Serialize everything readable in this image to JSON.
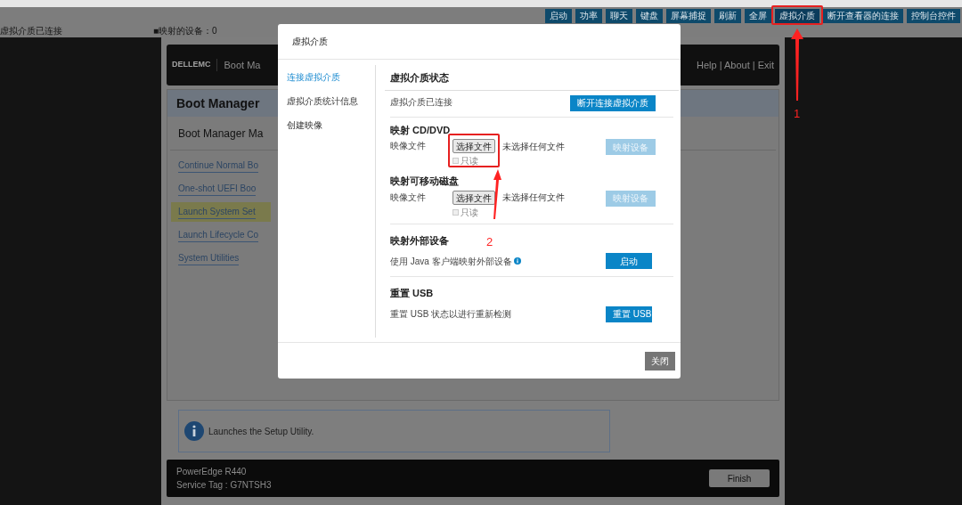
{
  "toolbar": {
    "buttons": [
      {
        "label": "启动",
        "selected": false
      },
      {
        "label": "功率",
        "selected": false
      },
      {
        "label": "聊天",
        "selected": false
      },
      {
        "label": "键盘",
        "selected": false
      },
      {
        "label": "屏幕捕捉",
        "selected": false
      },
      {
        "label": "刷新",
        "selected": false
      },
      {
        "label": "全屏",
        "selected": false
      },
      {
        "label": "虚拟介质",
        "selected": true
      },
      {
        "label": "断开查看器的连接",
        "selected": false
      },
      {
        "label": "控制台控件",
        "selected": false
      }
    ]
  },
  "status_bar": {
    "connection": "虚拟介质已连接",
    "mapped_devices": "■映射的设备：0"
  },
  "bios": {
    "brand": "DELLEMC",
    "header_title": "Boot Ma",
    "header_links": "Help | About | Exit",
    "panel_title": "Boot Manager",
    "section_title": "Boot Manager Ma",
    "items": [
      {
        "label": "Continue Normal Bo",
        "selected": false
      },
      {
        "label": "One-shot UEFI Boo",
        "selected": false
      },
      {
        "label": "Launch System Set",
        "selected": true
      },
      {
        "label": "Launch Lifecycle Co",
        "selected": false
      },
      {
        "label": "System Utilities",
        "selected": false
      }
    ],
    "info": "Launches the Setup Utility.",
    "model": "PowerEdge R440",
    "service_tag": "Service Tag : G7NTSH3",
    "finish": "Finish"
  },
  "dialog": {
    "title": "虚拟介质",
    "nav": [
      {
        "label": "连接虚拟介质",
        "selected": true
      },
      {
        "label": "虚拟介质统计信息",
        "selected": false
      },
      {
        "label": "创建映像",
        "selected": false
      }
    ],
    "sections": [
      {
        "kind": "status",
        "title": "虚拟介质状态",
        "text": "虚拟介质已连接",
        "button": {
          "label": "断开连接虚拟介质",
          "disabled": false
        }
      },
      {
        "kind": "image",
        "title": "映射 CD/DVD",
        "text": "映像文件",
        "file_button": "选择文件",
        "file_status": "未选择任何文件",
        "readonly": {
          "label": "只读",
          "checked": false,
          "disabled": true
        },
        "button": {
          "label": "映射设备",
          "disabled": true
        }
      },
      {
        "kind": "image",
        "title": "映射可移动磁盘",
        "text": "映像文件",
        "file_button": "选择文件",
        "file_status": "未选择任何文件",
        "readonly": {
          "label": "只读",
          "checked": false,
          "disabled": true
        },
        "button": {
          "label": "映射设备",
          "disabled": true
        }
      },
      {
        "kind": "java",
        "title": "映射外部设备",
        "text": "使用 Java 客户端映射外部设备",
        "button": {
          "label": "启动",
          "disabled": false
        }
      },
      {
        "kind": "usb",
        "title": "重置 USB",
        "text": "重置 USB 状态以进行重新检测",
        "button": {
          "label": "重置 USB",
          "disabled": false
        }
      }
    ],
    "close": "关闭"
  },
  "annotations": [
    {
      "label": "1"
    },
    {
      "label": "2"
    }
  ]
}
